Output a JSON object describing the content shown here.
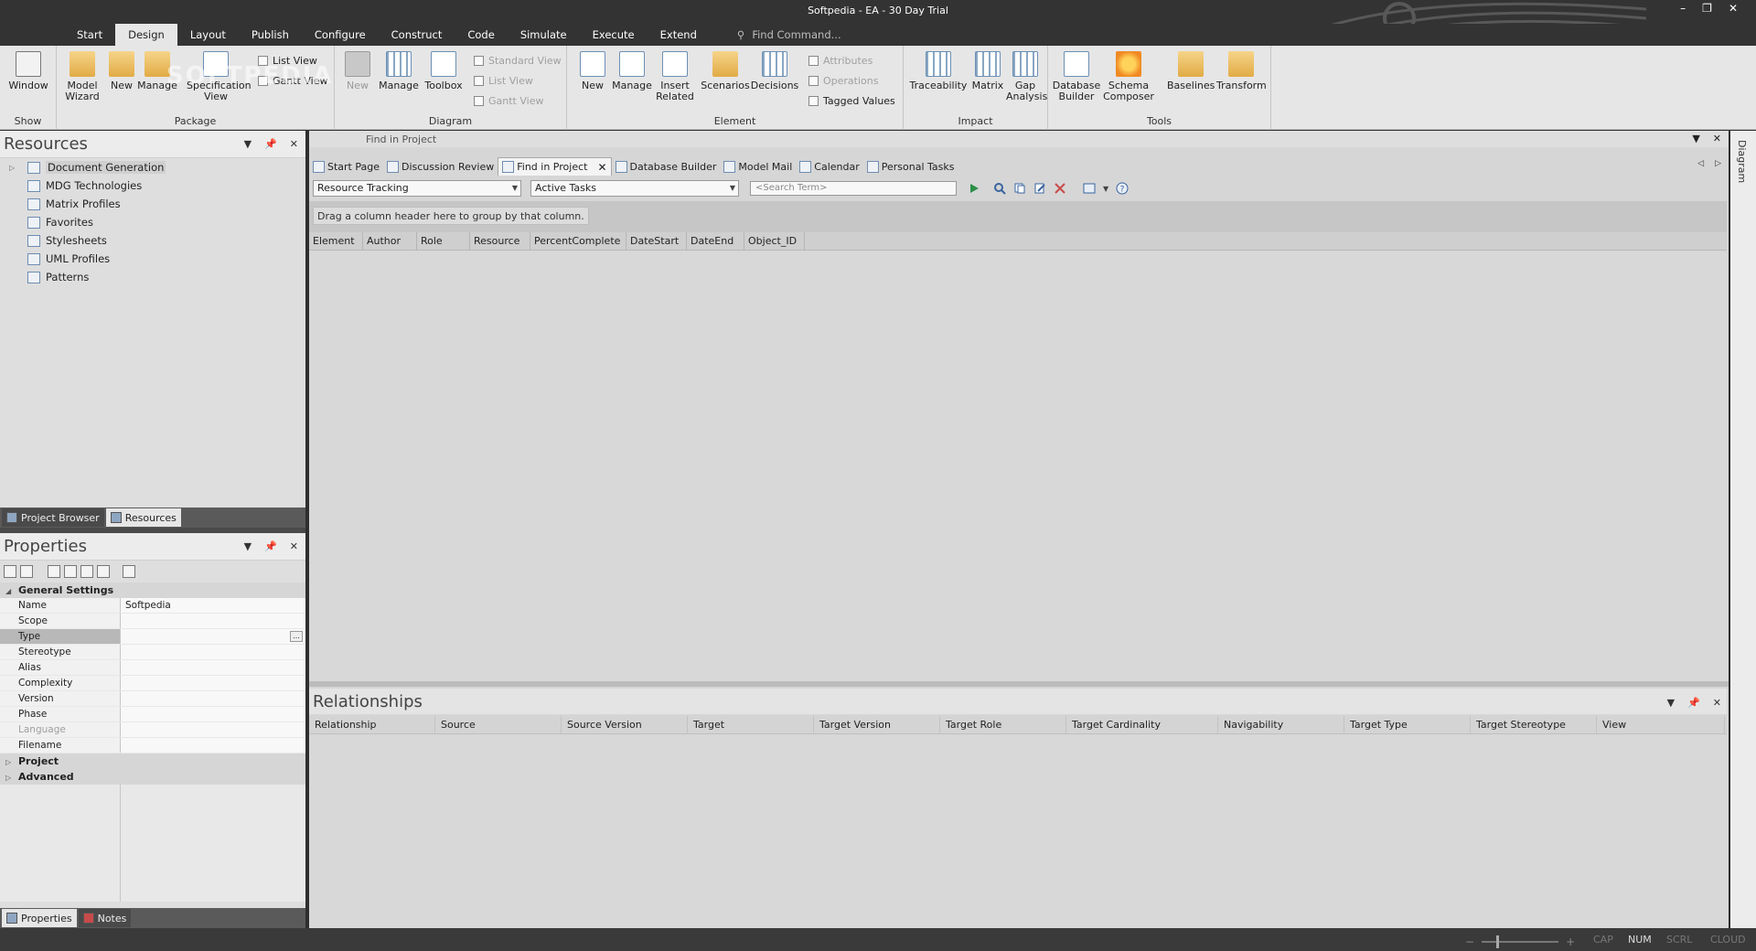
{
  "window": {
    "title": "Softpedia - EA - 30 Day Trial",
    "watermark": "SOFTPEDIA"
  },
  "ribbon_tabs": [
    "Start",
    "Design",
    "Layout",
    "Publish",
    "Configure",
    "Construct",
    "Code",
    "Simulate",
    "Execute",
    "Extend"
  ],
  "active_tab": "Design",
  "find_command": "Find Command...",
  "ribbon": {
    "show": {
      "label": "Show",
      "window": "Window"
    },
    "package": {
      "label": "Package",
      "model_wizard": [
        "Model",
        "Wizard"
      ],
      "new": "New",
      "manage": "Manage",
      "spec_view": [
        "Specification",
        "View"
      ],
      "list_view": "List View",
      "gantt_view": "Gantt View"
    },
    "diagram": {
      "label": "Diagram",
      "new": "New",
      "manage": "Manage",
      "toolbox": "Toolbox",
      "standard_view": "Standard View",
      "list_view": "List View",
      "gantt_view": "Gantt View"
    },
    "element": {
      "label": "Element",
      "new": "New",
      "manage": "Manage",
      "insert_related": [
        "Insert",
        "Related"
      ],
      "scenarios": "Scenarios",
      "decisions": "Decisions",
      "attributes": "Attributes",
      "operations": "Operations",
      "tagged_values": "Tagged Values"
    },
    "impact": {
      "label": "Impact",
      "traceability": "Traceability",
      "matrix": "Matrix",
      "gap_analysis": [
        "Gap",
        "Analysis"
      ]
    },
    "tools": {
      "label": "Tools",
      "db_builder": [
        "Database",
        "Builder"
      ],
      "schema_composer": [
        "Schema",
        "Composer"
      ],
      "baselines": "Baselines",
      "transform": "Transform"
    }
  },
  "resources": {
    "title": "Resources",
    "items": [
      "Document Generation",
      "MDG Technologies",
      "Matrix Profiles",
      "Favorites",
      "Stylesheets",
      "UML Profiles",
      "Patterns"
    ],
    "tabs": [
      "Project Browser",
      "Resources"
    ]
  },
  "properties": {
    "title": "Properties",
    "general": "General Settings",
    "rows": [
      {
        "k": "Name",
        "v": "Softpedia"
      },
      {
        "k": "Scope",
        "v": ""
      },
      {
        "k": "Type",
        "v": ""
      },
      {
        "k": "Stereotype",
        "v": ""
      },
      {
        "k": "Alias",
        "v": ""
      },
      {
        "k": "Complexity",
        "v": ""
      },
      {
        "k": "Version",
        "v": ""
      },
      {
        "k": "Phase",
        "v": ""
      },
      {
        "k": "Language",
        "v": ""
      },
      {
        "k": "Filename",
        "v": ""
      }
    ],
    "categories": [
      "Project",
      "Advanced"
    ],
    "tabs": [
      "Properties",
      "Notes"
    ],
    "ellipsis": "..."
  },
  "main": {
    "header": "Find in Project",
    "tabs": [
      "Start Page",
      "Discussion Review",
      "Find in Project",
      "Database Builder",
      "Model Mail",
      "Calendar",
      "Personal Tasks"
    ],
    "active_tab": "Find in Project",
    "search_category": "Resource Tracking",
    "search_name": "Active Tasks",
    "search_placeholder": "<Search Term>",
    "group_hint": "Drag a column header here to group by that column.",
    "columns": [
      "Element",
      "Author",
      "Role",
      "Resource",
      "PercentComplete",
      "DateStart",
      "DateEnd",
      "Object_ID"
    ]
  },
  "relationships": {
    "title": "Relationships",
    "columns": [
      "Relationship",
      "Source",
      "Source Version",
      "Target",
      "Target Version",
      "Target Role",
      "Target Cardinality",
      "Navigability",
      "Target Type",
      "Target Stereotype",
      "View"
    ]
  },
  "right_dock": "Diagram",
  "status": {
    "zoom_minus": "−",
    "zoom_plus": "+",
    "indicators": [
      "CAP",
      "NUM",
      "SCRL",
      "CLOUD"
    ]
  },
  "colors": {
    "ribbon": "#e6e6e6",
    "chrome": "#333333",
    "panel": "#dedede",
    "grid_bg": "#d8d8d8"
  }
}
